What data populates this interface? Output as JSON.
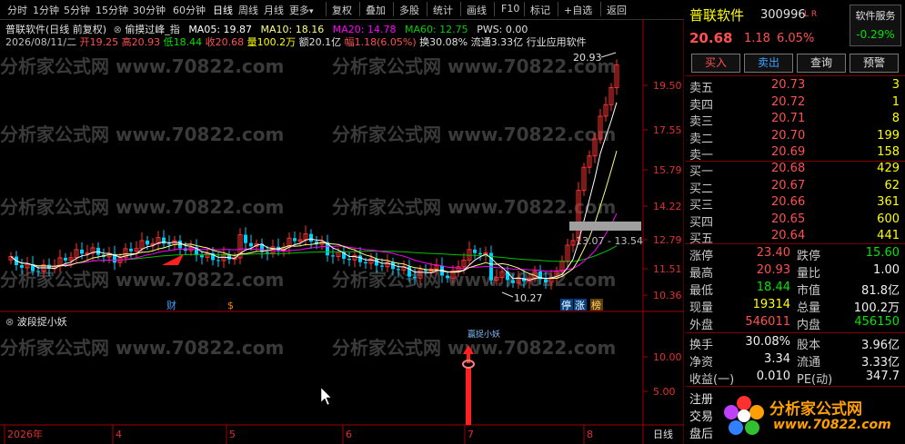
{
  "toolbar": {
    "periods": [
      "分时",
      "1分钟",
      "5分钟",
      "15分钟",
      "30分钟",
      "60分钟",
      "日线",
      "周线",
      "月线",
      "更多"
    ],
    "active_period": "日线",
    "actions": [
      "复权",
      "叠加",
      "多股",
      "统计",
      "画线",
      "F10",
      "标记",
      "+自选",
      "返回"
    ]
  },
  "main_chart": {
    "title": "普联软件(日线 前复权)",
    "indicator": "偷摸过峰_指",
    "ma05": "MA05: 19.87",
    "ma10": "MA10: 18.16",
    "ma20": "MA20: 14.78",
    "ma60": "MA60: 12.75",
    "pws": "PWS: 0.00",
    "ohlc": {
      "date": "2026/08/11/二",
      "open": "开19.25",
      "high": "高20.93",
      "low": "低18.44",
      "close": "收20.68",
      "volume": "量100.2万",
      "amount": "额20.1亿",
      "change": "幅1.18(6.05%)",
      "turnover": "换30.08%",
      "float": "流通3.33亿",
      "industry": "行业应用软件"
    },
    "y_ticks": [
      "19.50",
      "17.55",
      "15.79",
      "14.22",
      "12.79",
      "11.51",
      "10.36"
    ],
    "high_label": "20.93",
    "low_label": "10.27",
    "box_label": "13.07 - 13.54",
    "markers": [
      "财",
      "$",
      "停",
      "涨",
      "榜"
    ]
  },
  "sub_chart": {
    "title": "波段捉小妖",
    "y_ticks": [
      "10.00",
      "5.00"
    ],
    "signal_label": "赢捉小妖"
  },
  "time_axis": {
    "labels": [
      "2026年",
      "4",
      "5",
      "6",
      "7",
      "8"
    ],
    "period": "日线"
  },
  "watermark": "分析家公式网 www.70822.com",
  "quote_panel": {
    "name": "普联软件",
    "code": "300996",
    "flags": "L R",
    "service_label": "软件服务",
    "service_change": "-0.29%",
    "price": "20.68",
    "change": "1.18",
    "change_pct": "6.05%",
    "buttons": [
      "买入",
      "卖出",
      "查询",
      "预警"
    ],
    "sells": [
      {
        "label": "卖五",
        "price": "20.73",
        "vol": "3"
      },
      {
        "label": "卖四",
        "price": "20.72",
        "vol": "1"
      },
      {
        "label": "卖三",
        "price": "20.71",
        "vol": "8"
      },
      {
        "label": "卖二",
        "price": "20.70",
        "vol": "199"
      },
      {
        "label": "卖一",
        "price": "20.69",
        "vol": "158"
      }
    ],
    "buys": [
      {
        "label": "买一",
        "price": "20.68",
        "vol": "429"
      },
      {
        "label": "买二",
        "price": "20.67",
        "vol": "62"
      },
      {
        "label": "买三",
        "price": "20.66",
        "vol": "361"
      },
      {
        "label": "买四",
        "price": "20.65",
        "vol": "600"
      },
      {
        "label": "买五",
        "price": "20.64",
        "vol": "441"
      }
    ],
    "stats": [
      {
        "l1": "涨停",
        "v1": "23.40",
        "c1": "red",
        "l2": "跌停",
        "v2": "15.60",
        "c2": "green"
      },
      {
        "l1": "最高",
        "v1": "20.93",
        "c1": "red",
        "l2": "量比",
        "v2": "1.00",
        "c2": "white"
      },
      {
        "l1": "最低",
        "v1": "18.44",
        "c1": "green",
        "l2": "市值",
        "v2": "81.8亿",
        "c2": "white"
      },
      {
        "l1": "现量",
        "v1": "19314",
        "c1": "yellow",
        "l2": "总量",
        "v2": "100.2万",
        "c2": "white"
      },
      {
        "l1": "外盘",
        "v1": "546011",
        "c1": "red",
        "l2": "内盘",
        "v2": "456150",
        "c2": "green"
      }
    ],
    "stats2": [
      {
        "l1": "换手",
        "v1": "30.08%",
        "l2": "股本",
        "v2": "3.96亿"
      },
      {
        "l1": "净资",
        "v1": "3.34",
        "l2": "流通",
        "v2": "3.33亿"
      },
      {
        "l1": "收益(一)",
        "v1": "0.010",
        "l2": "PE(动)",
        "v2": "347.7"
      }
    ],
    "bottom_labels": [
      "注册",
      "交易",
      "盘后"
    ],
    "logo_text": "分析家公式网",
    "logo_url": "www.70822.com"
  }
}
